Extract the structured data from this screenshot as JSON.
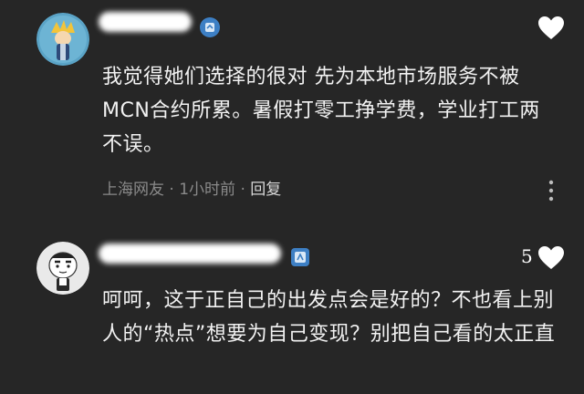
{
  "comments": [
    {
      "text": "我觉得她们选择的很对 先为本地市场服务不被MCN合约所累。暑假打零工挣学费，学业打工两不误。",
      "location": "上海网友",
      "separator": " · ",
      "time": "1小时前",
      "reply_label": "回复",
      "like_count": "",
      "icons": {
        "like": "heart-icon",
        "badge": "level-badge-icon",
        "more": "more-vertical-icon"
      }
    },
    {
      "text": "呵呵，这于正自己的出发点会是好的？不也看上别人的“热点”想要为自己变现？别把自己看的太正直",
      "like_count": "5",
      "icons": {
        "like": "heart-icon",
        "badge": "level-badge-icon"
      }
    }
  ],
  "colors": {
    "background": "#262626",
    "text": "#f2f2f2",
    "meta": "#8a8a8a",
    "badge": "#3d7fc4"
  }
}
